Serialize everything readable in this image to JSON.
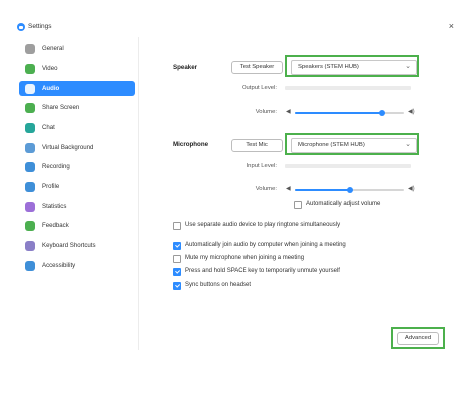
{
  "window": {
    "title": "Settings",
    "close_glyph": "×"
  },
  "sidebar": {
    "items": [
      {
        "label": "General",
        "icon": "gear-icon",
        "color": "#9e9e9e",
        "active": false
      },
      {
        "label": "Video",
        "icon": "video-icon",
        "color": "#4caf50",
        "active": false
      },
      {
        "label": "Audio",
        "icon": "headphones-icon",
        "color": "#2d8cff",
        "active": true
      },
      {
        "label": "Share Screen",
        "icon": "share-screen-icon",
        "color": "#4caf50",
        "active": false
      },
      {
        "label": "Chat",
        "icon": "chat-icon",
        "color": "#26a69a",
        "active": false
      },
      {
        "label": "Virtual Background",
        "icon": "virtual-background-icon",
        "color": "#5c9bd6",
        "active": false
      },
      {
        "label": "Recording",
        "icon": "recording-icon",
        "color": "#3f8fd8",
        "active": false
      },
      {
        "label": "Profile",
        "icon": "profile-icon",
        "color": "#3f8fd8",
        "active": false
      },
      {
        "label": "Statistics",
        "icon": "statistics-icon",
        "color": "#9c6fd8",
        "active": false
      },
      {
        "label": "Feedback",
        "icon": "feedback-icon",
        "color": "#4caf50",
        "active": false
      },
      {
        "label": "Keyboard Shortcuts",
        "icon": "keyboard-icon",
        "color": "#8a7fc7",
        "active": false
      },
      {
        "label": "Accessibility",
        "icon": "accessibility-icon",
        "color": "#3f8fd8",
        "active": false
      }
    ]
  },
  "speaker": {
    "label": "Speaker",
    "test_button": "Test Speaker",
    "device": "Speakers (STEM HUB)",
    "output_level_label": "Output Level:",
    "volume_label": "Volume:",
    "volume": 0.8
  },
  "microphone": {
    "label": "Microphone",
    "test_button": "Test Mic",
    "device": "Microphone (STEM HUB)",
    "input_level_label": "Input Level:",
    "volume_label": "Volume:",
    "volume": 0.5,
    "auto_adjust_label": "Automatically adjust volume",
    "auto_adjust_checked": false
  },
  "options": [
    {
      "label": "Use separate audio device to play ringtone simultaneously",
      "checked": false
    },
    {
      "label": "Automatically join audio by computer when joining a meeting",
      "checked": true
    },
    {
      "label": "Mute my microphone when joining a meeting",
      "checked": false
    },
    {
      "label": "Press and hold SPACE key to temporarily unmute yourself",
      "checked": true
    },
    {
      "label": "Sync buttons on headset",
      "checked": true
    }
  ],
  "advanced_button": "Advanced",
  "colors": {
    "accent": "#2d8cff",
    "highlight": "#4cb04c"
  }
}
